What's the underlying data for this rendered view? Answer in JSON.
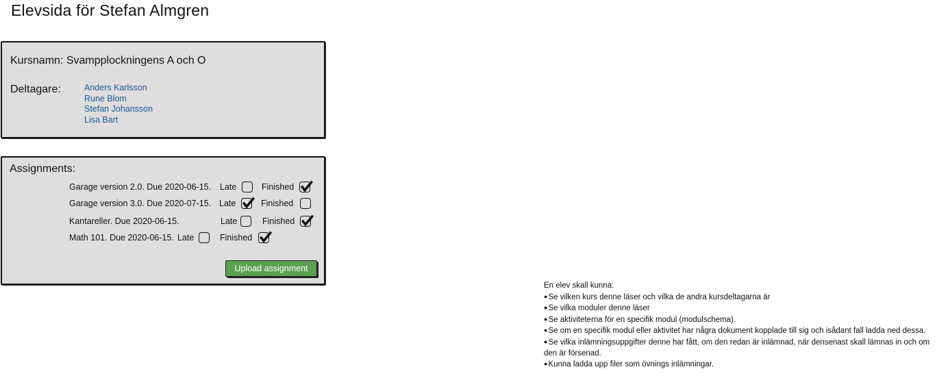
{
  "page": {
    "title": "Elevsida för Stefan Almgren"
  },
  "course": {
    "name": "Kursnamn: Svampplockningens A och O",
    "participants_label": "Deltagare:",
    "participants": [
      "Anders Karlsson",
      "Rune Blom",
      "Stefan Johansson",
      "Lisa Bart"
    ]
  },
  "assignments": {
    "title": "Assignments:",
    "late_label": "Late",
    "finished_label": "Finished",
    "items": [
      {
        "name": "Garage version 2.0. Due 2020-06-15.",
        "late": false,
        "finished": true
      },
      {
        "name": "Garage version 3.0. Due 2020-07-15.",
        "late": true,
        "finished": false
      },
      {
        "name": "Kantareller. Due 2020-06-15.",
        "late": false,
        "finished": true
      },
      {
        "name": "Math 101. Due 2020-06-15.",
        "late": false,
        "finished": true
      }
    ],
    "upload_label": "Upload assignment"
  },
  "notes": {
    "intro": "En elev skall kunna:",
    "items": [
      "Se vilken kurs denne läser och vilka de andra kursdeltagarna är",
      "Se vilka moduler denne läser",
      "Se aktiviteterna för en specifik modul (modulschema).",
      "Se om en specifik modul eller aktivitet har några dokument kopplade till sig och isådant fall ladda ned dessa.",
      "Se vilka inlämningsuppgifter denne har fått, om den redan är inlämnad, när densenast skall lämnas in och om den är försenad.",
      "Kunna ladda upp filer som övnings inlämningar."
    ]
  },
  "colors": {
    "panel_bg": "#dedede",
    "link": "#1a5a9a",
    "upload_button_bg": "#5aa050"
  }
}
